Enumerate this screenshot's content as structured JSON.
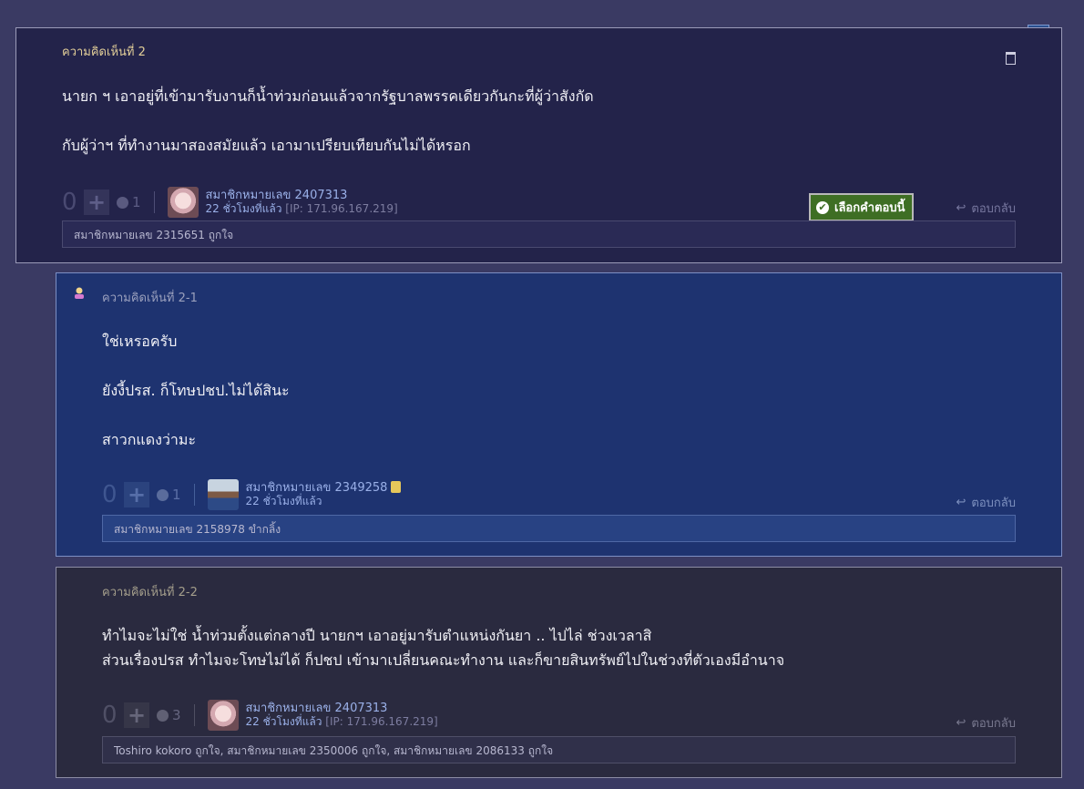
{
  "comments": [
    {
      "header": "ความคิดเห็นที่ 2",
      "lines": [
        "นายก ฯ เอาอยู่ที่เข้ามารับงานก็น้ำท่วมก่อนแล้วจากรัฐบาลพรรคเดียวกันกะที่ผู้ว่าสังกัด",
        "กับผู้ว่าฯ ที่ทำงานมาสองสมัยแล้ว เอามาเปรียบเทียบกันไม่ได้หรอก"
      ],
      "vote_count": "0",
      "emotion_count": "1",
      "user": "สมาชิกหมายเลข 2407313",
      "time": "22 ชั่วโมงที่แล้ว",
      "ip": "[IP: 171.96.167.219]",
      "choose_label": "เลือกคำตอบนี้",
      "reply_label": "ตอบกลับ",
      "likes": "สมาชิกหมายเลข 2315651 ถูกใจ"
    },
    {
      "header": "ความคิดเห็นที่ 2-1",
      "lines": [
        "ใช่เหรอครับ",
        "ยังงี้ปรส. ก็โทษปชป.ไม่ได้สินะ",
        "สาวกแดงว่ามะ"
      ],
      "vote_count": "0",
      "emotion_count": "1",
      "user": "สมาชิกหมายเลข 2349258",
      "time": "22 ชั่วโมงที่แล้ว",
      "reply_label": "ตอบกลับ",
      "likes": "สมาชิกหมายเลข 2158978 ขำกลิ้ง"
    },
    {
      "header": "ความคิดเห็นที่ 2-2",
      "lines": [
        "ทำไมจะไม่ใช่ น้ำท่วมตั้งแต่กลางปี  นายกฯ เอาอยู่มารับตำแหน่งกันยา ..  ไปไล่ ช่วงเวลาสิ",
        "ส่วนเรื่องปรส ทำไมจะโทษไม่ได้ ก็ปชป เข้ามาเปลี่ยนคณะทำงาน และก็ขายสินทรัพย์ไปในช่วงที่ตัวเองมีอำนาจ"
      ],
      "vote_count": "0",
      "emotion_count": "3",
      "user": "สมาชิกหมายเลข 2407313",
      "time": "22 ชั่วโมงที่แล้ว",
      "ip": "[IP: 171.96.167.219]",
      "reply_label": "ตอบกลับ",
      "likes": "Toshiro kokoro ถูกใจ, สมาชิกหมายเลข 2350006 ถูกใจ, สมาชิกหมายเลข 2086133 ถูกใจ"
    }
  ]
}
